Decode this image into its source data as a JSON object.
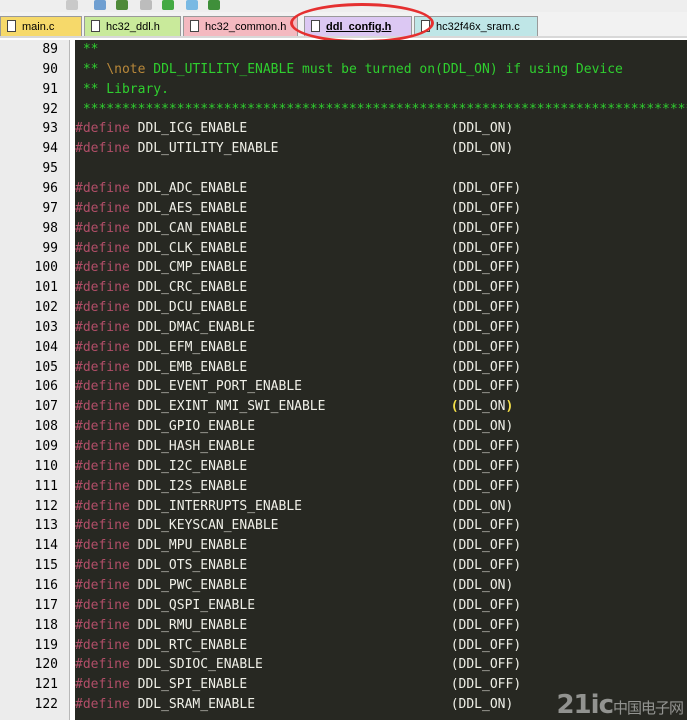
{
  "toolbar": {
    "icons": [
      "gear-icon",
      "tools-icon",
      "copy-icon",
      "paste-icon",
      "down-arrow-icon",
      "diamond-icon",
      "component-icon"
    ]
  },
  "tabs": [
    {
      "label": "main.c",
      "color": "#f6d96a"
    },
    {
      "label": "hc32_ddl.h",
      "color": "#c9ea9b"
    },
    {
      "label": "hc32_common.h",
      "color": "#f4b9c0"
    },
    {
      "label": "ddl_config.h",
      "color": "#dcc8f3",
      "active": true
    },
    {
      "label": "hc32f46x_sram.c",
      "color": "#bfe6e7"
    }
  ],
  "editor": {
    "lines": [
      {
        "num": "89",
        "type": "comment",
        "text": "**"
      },
      {
        "num": "90",
        "type": "note",
        "pre": "** ",
        "note": "\\note",
        "text": " DDL_UTILITY_ENABLE must be turned on(DDL_ON) if using Device"
      },
      {
        "num": "91",
        "type": "comment",
        "text": "** Library."
      },
      {
        "num": "92",
        "type": "comment",
        "text": "******************************************************************************"
      },
      {
        "num": "93",
        "type": "define",
        "name": "DDL_ICG_ENABLE",
        "value": "(DDL_ON)"
      },
      {
        "num": "94",
        "type": "define",
        "name": "DDL_UTILITY_ENABLE",
        "value": "(DDL_ON)"
      },
      {
        "num": "95",
        "type": "blank"
      },
      {
        "num": "96",
        "type": "define",
        "name": "DDL_ADC_ENABLE",
        "value": "(DDL_OFF)"
      },
      {
        "num": "97",
        "type": "define",
        "name": "DDL_AES_ENABLE",
        "value": "(DDL_OFF)"
      },
      {
        "num": "98",
        "type": "define",
        "name": "DDL_CAN_ENABLE",
        "value": "(DDL_OFF)"
      },
      {
        "num": "99",
        "type": "define",
        "name": "DDL_CLK_ENABLE",
        "value": "(DDL_OFF)"
      },
      {
        "num": "100",
        "type": "define",
        "name": "DDL_CMP_ENABLE",
        "value": "(DDL_OFF)"
      },
      {
        "num": "101",
        "type": "define",
        "name": "DDL_CRC_ENABLE",
        "value": "(DDL_OFF)"
      },
      {
        "num": "102",
        "type": "define",
        "name": "DDL_DCU_ENABLE",
        "value": "(DDL_OFF)"
      },
      {
        "num": "103",
        "type": "define",
        "name": "DDL_DMAC_ENABLE",
        "value": "(DDL_OFF)"
      },
      {
        "num": "104",
        "type": "define",
        "name": "DDL_EFM_ENABLE",
        "value": "(DDL_OFF)"
      },
      {
        "num": "105",
        "type": "define",
        "name": "DDL_EMB_ENABLE",
        "value": "(DDL_OFF)"
      },
      {
        "num": "106",
        "type": "define",
        "name": "DDL_EVENT_PORT_ENABLE",
        "value": "(DDL_OFF)"
      },
      {
        "num": "107",
        "type": "define",
        "name": "DDL_EXINT_NMI_SWI_ENABLE",
        "value": "DDL_ON",
        "highlight": true
      },
      {
        "num": "108",
        "type": "define",
        "name": "DDL_GPIO_ENABLE",
        "value": "(DDL_ON)"
      },
      {
        "num": "109",
        "type": "define",
        "name": "DDL_HASH_ENABLE",
        "value": "(DDL_OFF)"
      },
      {
        "num": "110",
        "type": "define",
        "name": "DDL_I2C_ENABLE",
        "value": "(DDL_OFF)"
      },
      {
        "num": "111",
        "type": "define",
        "name": "DDL_I2S_ENABLE",
        "value": "(DDL_OFF)"
      },
      {
        "num": "112",
        "type": "define",
        "name": "DDL_INTERRUPTS_ENABLE",
        "value": "(DDL_ON)"
      },
      {
        "num": "113",
        "type": "define",
        "name": "DDL_KEYSCAN_ENABLE",
        "value": "(DDL_OFF)"
      },
      {
        "num": "114",
        "type": "define",
        "name": "DDL_MPU_ENABLE",
        "value": "(DDL_OFF)"
      },
      {
        "num": "115",
        "type": "define",
        "name": "DDL_OTS_ENABLE",
        "value": "(DDL_OFF)"
      },
      {
        "num": "116",
        "type": "define",
        "name": "DDL_PWC_ENABLE",
        "value": "(DDL_ON)"
      },
      {
        "num": "117",
        "type": "define",
        "name": "DDL_QSPI_ENABLE",
        "value": "(DDL_OFF)"
      },
      {
        "num": "118",
        "type": "define",
        "name": "DDL_RMU_ENABLE",
        "value": "(DDL_OFF)"
      },
      {
        "num": "119",
        "type": "define",
        "name": "DDL_RTC_ENABLE",
        "value": "(DDL_OFF)"
      },
      {
        "num": "120",
        "type": "define",
        "name": "DDL_SDIOC_ENABLE",
        "value": "(DDL_OFF)"
      },
      {
        "num": "121",
        "type": "define",
        "name": "DDL_SPI_ENABLE",
        "value": "(DDL_OFF)"
      },
      {
        "num": "122",
        "type": "define",
        "name": "DDL_SRAM_ENABLE",
        "value": "(DDL_ON)"
      }
    ],
    "keyword": "#define"
  },
  "watermark": {
    "main": "21ic",
    "sub": "中国电子网"
  },
  "colors": {
    "editor_bg": "#272822",
    "keyword": "#b14e68",
    "comment": "#2fcf2f",
    "highlight_ring": "#e53030"
  }
}
